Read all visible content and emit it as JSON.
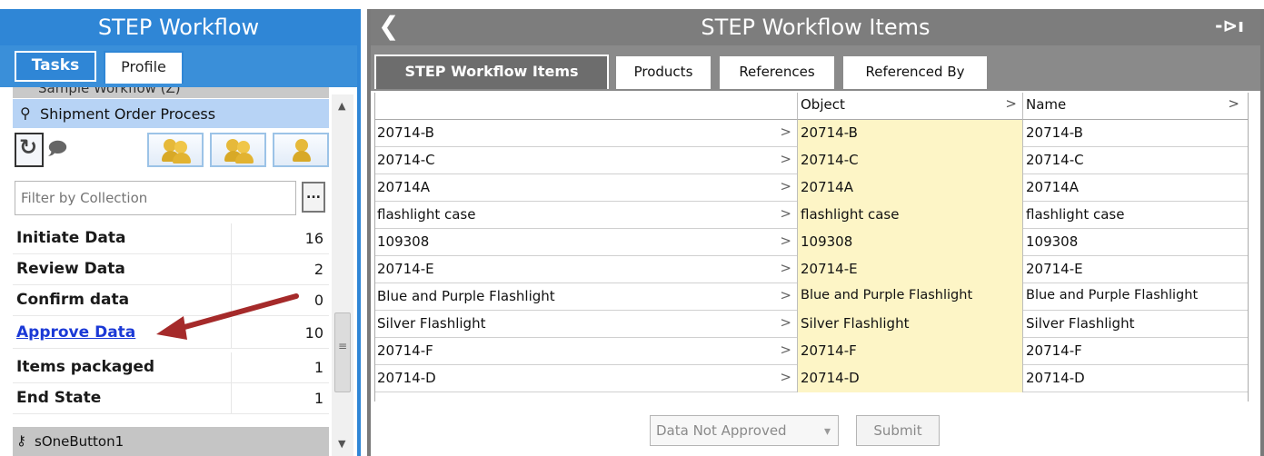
{
  "left_panel": {
    "title": "STEP Workflow",
    "tabs": [
      {
        "label": "Tasks"
      },
      {
        "label": "Profile"
      }
    ],
    "workflow_above": "Sample Workflow (Z)",
    "selected_workflow": "Shipment Order Process",
    "filter_placeholder": "Filter by Collection",
    "filter_button": "...",
    "states": [
      {
        "name": "Initiate Data",
        "count": "16"
      },
      {
        "name": "Review Data",
        "count": "2"
      },
      {
        "name": "Confirm data",
        "count": "0"
      },
      {
        "name": "Approve Data",
        "count": "10"
      },
      {
        "name": "Items packaged",
        "count": "1"
      },
      {
        "name": "End State",
        "count": "1"
      }
    ],
    "bottom_item": "sOneButton1"
  },
  "right_panel": {
    "title": "STEP Workflow Items",
    "tabs": [
      {
        "label": "STEP Workflow Items"
      },
      {
        "label": "Products"
      },
      {
        "label": "References"
      },
      {
        "label": "Referenced By"
      }
    ],
    "columns": [
      "",
      "Object",
      "Name"
    ],
    "rows": [
      [
        "20714-B",
        "20714-B",
        "20714-B"
      ],
      [
        "20714-C",
        "20714-C",
        "20714-C"
      ],
      [
        "20714A",
        "20714A",
        "20714A"
      ],
      [
        "flashlight case",
        "flashlight case",
        "flashlight case"
      ],
      [
        "109308",
        "109308",
        "109308"
      ],
      [
        "20714-E",
        "20714-E",
        "20714-E"
      ],
      [
        "Blue and Purple Flashlight",
        "Blue and Purple Flashlight",
        "Blue and Purple Flashlight"
      ],
      [
        "Silver Flashlight",
        "Silver Flashlight",
        "Silver Flashlight"
      ],
      [
        "20714-F",
        "20714-F",
        "20714-F"
      ],
      [
        "20714-D",
        "20714-D",
        "20714-D"
      ]
    ],
    "status_select": "Data Not Approved",
    "submit_label": "Submit"
  },
  "colors": {
    "left_accent": "#2f86d6",
    "right_header": "#7d7d7d",
    "object_cell": "#fdf5c6",
    "link": "#1b39d6",
    "arrow": "#a52a2a"
  },
  "icons": [
    "pin-icon",
    "refresh-icon",
    "comment-icon",
    "group-icon",
    "user-icon",
    "key-icon",
    "back-icon",
    "unpin-icon",
    "chevron-right-icon",
    "dropdown-icon"
  ]
}
